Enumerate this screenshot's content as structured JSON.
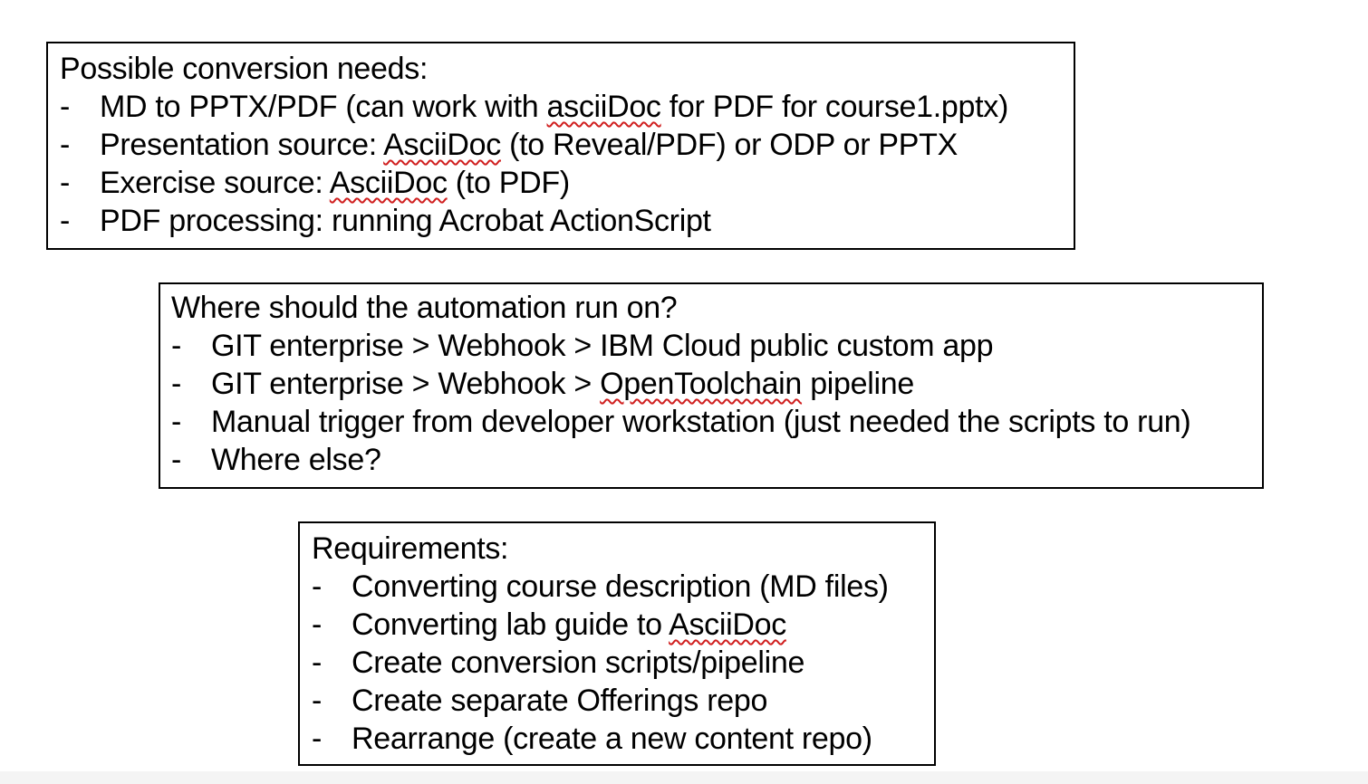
{
  "box1": {
    "heading": "Possible conversion needs:",
    "bullet": "-",
    "items": [
      {
        "before": "MD to PPTX/PDF (can work with ",
        "flagged": "asciiDoc",
        "after": " for PDF for course1.pptx)"
      },
      {
        "before": "Presentation source: ",
        "flagged": "AsciiDoc",
        "after": " (to Reveal/PDF) or ODP or PPTX"
      },
      {
        "before": "Exercise source: ",
        "flagged": "AsciiDoc",
        "after": " (to PDF)"
      },
      {
        "before": "PDF processing: running Acrobat ActionScript",
        "flagged": "",
        "after": ""
      }
    ]
  },
  "box2": {
    "heading": "Where should the automation run on?",
    "bullet": "-",
    "items": [
      {
        "before": "GIT enterprise > Webhook > IBM Cloud public custom app",
        "flagged": "",
        "after": ""
      },
      {
        "before": "GIT enterprise > Webhook > ",
        "flagged": "OpenToolchain",
        "after": " pipeline"
      },
      {
        "before": "Manual trigger from developer workstation (just needed the scripts to run)",
        "flagged": "",
        "after": ""
      },
      {
        "before": "Where else?",
        "flagged": "",
        "after": ""
      }
    ]
  },
  "box3": {
    "heading": "Requirements:",
    "bullet": "-",
    "items": [
      {
        "before": "Converting course description (MD files)",
        "flagged": "",
        "after": ""
      },
      {
        "before": "Converting lab guide to ",
        "flagged": "AsciiDoc",
        "after": ""
      },
      {
        "before": "Create conversion scripts/pipeline",
        "flagged": "",
        "after": ""
      },
      {
        "before": "Create separate Offerings repo",
        "flagged": "",
        "after": ""
      },
      {
        "before": "Rearrange (create a new content repo)",
        "flagged": "",
        "after": ""
      }
    ]
  },
  "colors": {
    "text": "#000000",
    "border": "#000000",
    "spellcheck_underline": "#d01f1f",
    "background": "#ffffff"
  }
}
